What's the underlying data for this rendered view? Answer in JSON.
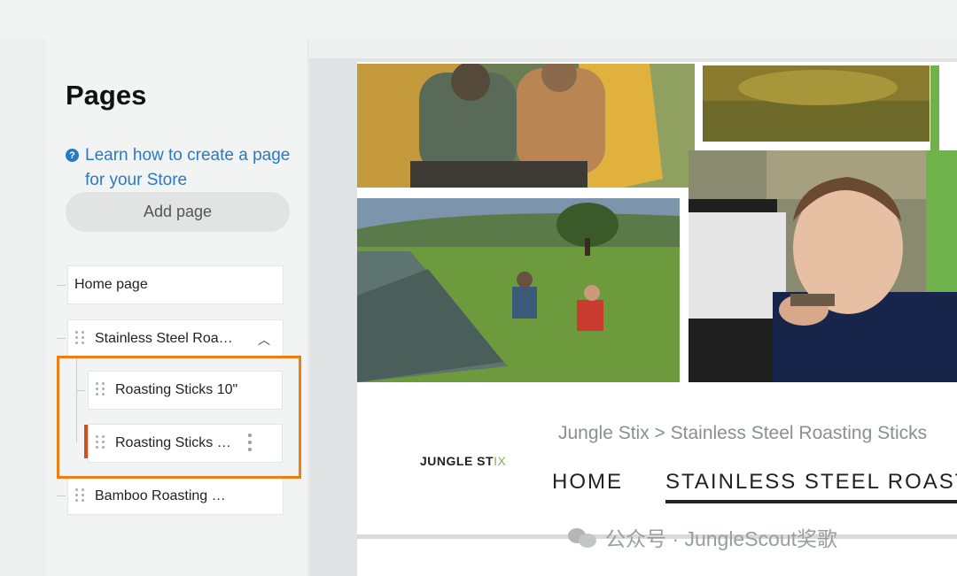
{
  "sidebar": {
    "title": "Pages",
    "help_icon": "?",
    "help_link": "Learn how to create a page for your Store",
    "add_page": "Add page",
    "tree": [
      {
        "label": "Home page"
      },
      {
        "label": "Stainless Steel Roa…",
        "expanded": true,
        "children": [
          {
            "label": "Roasting Sticks 10\""
          },
          {
            "label": "Roasting Sticks …",
            "selected": true
          }
        ]
      },
      {
        "label": "Bamboo Roasting …"
      }
    ]
  },
  "preview": {
    "breadcrumb": "Jungle Stix  >  Stainless Steel Roasting Sticks",
    "logo_main": "JUNGLE ST",
    "logo_accent": "IX",
    "nav_home": "HOME",
    "nav_active": "STAINLESS STEEL ROAST",
    "images": [
      "family-camping-tent-photo",
      "grass-field-photo",
      "green-meadow-tent-photo",
      "child-eating-smore-photo"
    ]
  },
  "watermark": "公众号 · JungleScout奖歌",
  "colors": {
    "link": "#2b79c4",
    "highlight": "#f07d14",
    "active_bar": "#cd4f22"
  }
}
